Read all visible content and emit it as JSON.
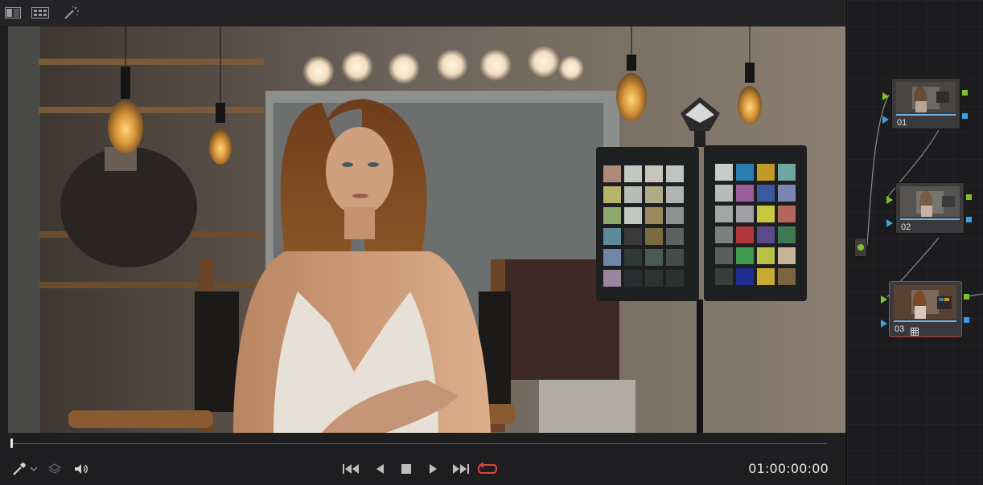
{
  "viewer": {
    "toolbar": {
      "icons": [
        "split-view-icon",
        "gallery-grid-icon",
        "magic-wand-icon"
      ]
    },
    "transport": {
      "timecode": "01:00:00:00",
      "loop_active_color": "#e0453d",
      "left_tools": [
        "eyedropper-icon",
        "chevron-down-icon",
        "layers-icon",
        "speaker-icon"
      ],
      "controls": [
        "skip-to-start-icon",
        "play-reverse-icon",
        "stop-icon",
        "play-icon",
        "skip-to-end-icon",
        "loop-icon"
      ]
    },
    "playhead_fraction": 0.0
  },
  "node_graph": {
    "nodes": [
      {
        "label": "01",
        "selected": false
      },
      {
        "label": "02",
        "selected": false
      },
      {
        "label": "03",
        "selected": true,
        "badge": "grid-icon"
      }
    ],
    "colors": {
      "rgb_input_port": "#7ec32b",
      "alpha_port": "#3aa0e6",
      "selected_border": "#c23a33"
    }
  }
}
